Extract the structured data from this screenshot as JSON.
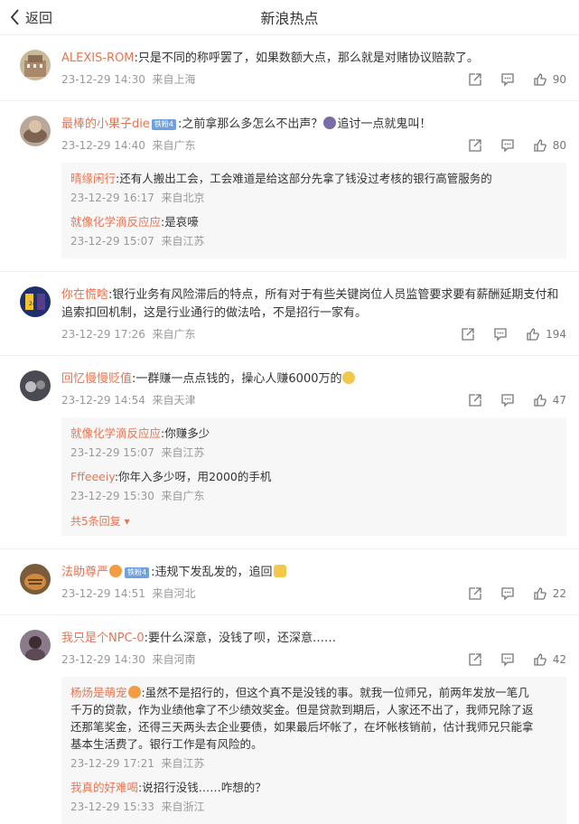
{
  "header": {
    "back_label": "返回",
    "title": "新浪热点"
  },
  "comments": [
    {
      "name": "ALEXIS-ROM",
      "text": ":只是不同的称呼罢了，如果数额大点，那么就是对赌协议赔款了。",
      "time": "23-12-29 14:30",
      "location": "来自上海",
      "likes": "90",
      "replies": []
    },
    {
      "name": "最棒的小果子die",
      "badge": "铁粉4",
      "text": ":之前拿那么多怎么不出声？",
      "text2": "追讨一点就鬼叫！",
      "time": "23-12-29 14:40",
      "location": "来自广东",
      "likes": "80",
      "replies": [
        {
          "name": "晴缘闲行",
          "text": ":还有人搬出工会，工会难道是给这部分先拿了钱没过考核的银行高管服务的",
          "time": "23-12-29 16:17",
          "location": "来自北京"
        },
        {
          "name": "就像化学滴反应应",
          "text": ":是哀嚎",
          "time": "23-12-29 15:07",
          "location": "来自江苏"
        }
      ]
    },
    {
      "name": "你在慌啥",
      "text": ":银行业务有风险滞后的特点，所有对于有些关键岗位人员监管要求要有薪酬延期支付和",
      "text2": "追索扣回机制，这是行业通行的做法哈，不是招行一家有。",
      "time": "23-12-29 17:26",
      "location": "来自广东",
      "likes": "194",
      "replies": []
    },
    {
      "name": "回忆慢慢贬值",
      "text": ":一群赚一点点钱的，操心人赚6000万的",
      "time": "23-12-29 14:54",
      "location": "来自天津",
      "likes": "47",
      "replies": [
        {
          "name": "就像化学滴反应应",
          "text": ":你赚多少",
          "time": "23-12-29 15:07",
          "location": "来自江苏"
        },
        {
          "name": "Fffeeeiy",
          "text": ":你年入多少呀，用2000的手机",
          "time": "23-12-29 15:30",
          "location": "来自广东"
        }
      ],
      "more": "共5条回复"
    },
    {
      "name": "法助尊严",
      "badge": "铁粉4",
      "text": ":违规下发乱发的，追回",
      "time": "23-12-29 14:51",
      "location": "来自河北",
      "likes": "22",
      "replies": []
    },
    {
      "name": "我只是个NPC-0",
      "text": ":要什么深意，没钱了呗，还深意……",
      "time": "23-12-29 14:30",
      "location": "来自河南",
      "likes": "42",
      "replies": [
        {
          "name": "杨炀是萌宠",
          "text": ":虽然不是招行的，但这个真不是没钱的事。就我一位师兄，前两年发放一笔几",
          "text2": "千万的贷款，作为业绩他拿了不少绩效奖金。但是贷款到期后，人家还不出了，我师兄除了返",
          "text3": "还那笔奖金，还得三天两头去企业要债，如果最后坏帐了，在坏帐核销前，估计我师兄只能拿",
          "text4": "基本生活费了。银行工作是有风险的。",
          "time": "23-12-29 17:21",
          "location": "来自江苏"
        },
        {
          "name": "我真的好难喝",
          "text": ":说招行没钱……咋想的？",
          "time": "23-12-29 15:33",
          "location": "来自浙江"
        }
      ]
    }
  ]
}
